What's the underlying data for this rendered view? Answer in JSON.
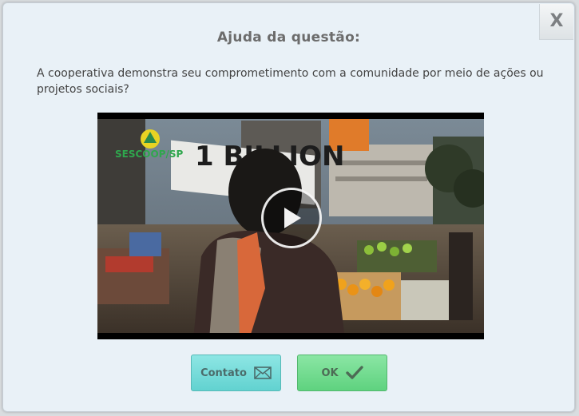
{
  "dialog": {
    "title": "Ajuda da questão:",
    "question": "A cooperativa demonstra seu comprometimento com a comunidade por meio de ações ou projetos sociais?",
    "close_label": "X"
  },
  "video": {
    "overlay_logo_text": "SESCOOP/SP",
    "banner_text": "1 BILLION"
  },
  "buttons": {
    "contato_label": "Contato",
    "ok_label": "OK"
  },
  "colors": {
    "dialog_bg": "#e9f1f7",
    "contato_bg": "#6fd9d7",
    "ok_bg": "#6ddb8c"
  }
}
